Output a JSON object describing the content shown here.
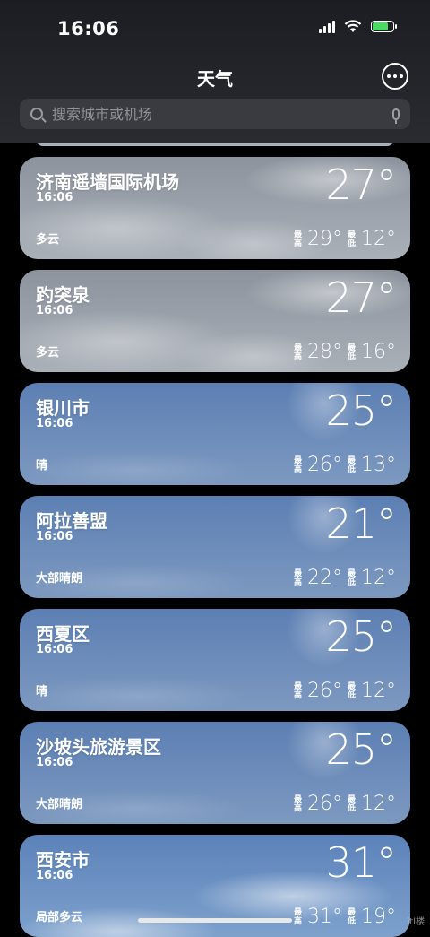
{
  "status": {
    "time": "16:06",
    "battery_level": 0.8
  },
  "header": {
    "title": "天气"
  },
  "search": {
    "placeholder": "搜索城市或机场"
  },
  "hilo_labels": {
    "high": "最高",
    "low": "最低"
  },
  "cities": [
    {
      "name": "济南遥墙国际机场",
      "time": "16:06",
      "condition": "多云",
      "temp": "27°",
      "high": "29°",
      "low": "12°",
      "style": "cloudy"
    },
    {
      "name": "趵突泉",
      "time": "16:06",
      "condition": "多云",
      "temp": "27°",
      "high": "28°",
      "low": "16°",
      "style": "cloudy"
    },
    {
      "name": "银川市",
      "time": "16:06",
      "condition": "晴",
      "temp": "25°",
      "high": "26°",
      "low": "13°",
      "style": "sunny"
    },
    {
      "name": "阿拉善盟",
      "time": "16:06",
      "condition": "大部晴朗",
      "temp": "21°",
      "high": "22°",
      "low": "12°",
      "style": "sunny"
    },
    {
      "name": "西夏区",
      "time": "16:06",
      "condition": "晴",
      "temp": "25°",
      "high": "26°",
      "low": "12°",
      "style": "sunny"
    },
    {
      "name": "沙坡头旅游景区",
      "time": "16:06",
      "condition": "大部晴朗",
      "temp": "25°",
      "high": "26°",
      "low": "12°",
      "style": "sunny"
    },
    {
      "name": "西安市",
      "time": "16:06",
      "condition": "局部多云",
      "temp": "31°",
      "high": "31°",
      "low": "19°",
      "style": "partly"
    }
  ],
  "watermark": "itl楼"
}
